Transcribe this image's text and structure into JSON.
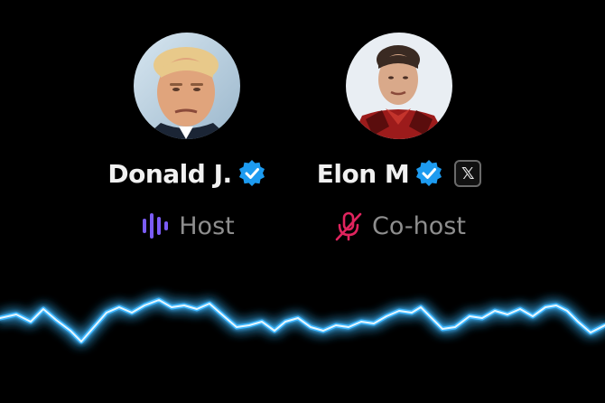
{
  "speakers": [
    {
      "name": "Donald J.",
      "role": "Host",
      "verified": true,
      "role_icon": "speaking-bars-icon",
      "role_icon_color": "#7b5cf6"
    },
    {
      "name": "Elon M",
      "role": "Co-host",
      "verified": true,
      "has_x_badge": true,
      "x_badge_label": "𝕏",
      "role_icon": "microphone-muted-icon",
      "role_icon_color": "#e0245e"
    }
  ],
  "colors": {
    "background": "#000000",
    "verified_blue": "#1d9bf0",
    "waveform_glow": "#3fb8ff",
    "role_text": "#8e8e8e"
  }
}
